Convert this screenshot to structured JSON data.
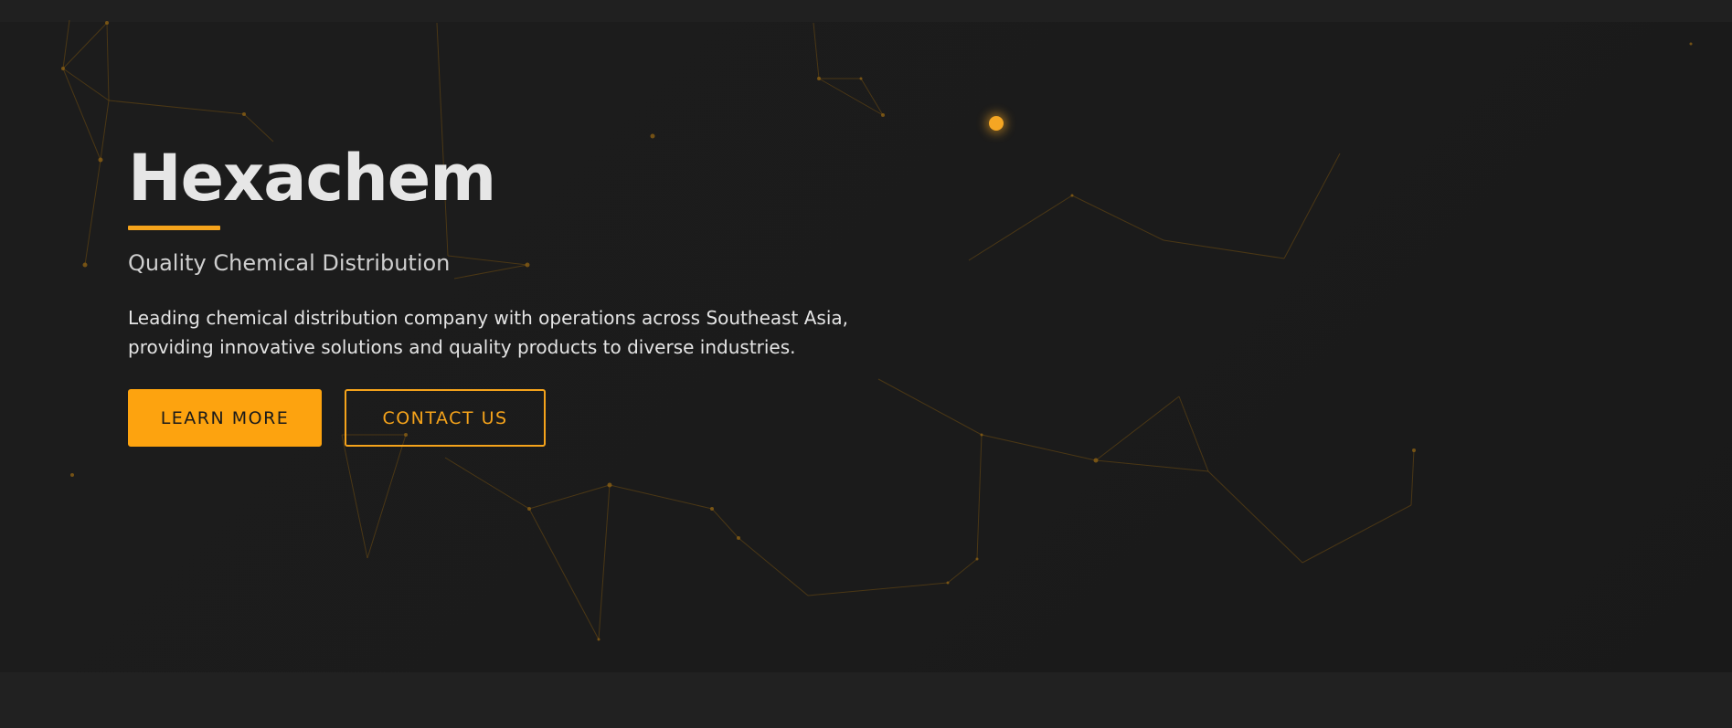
{
  "hero": {
    "title": "Hexachem",
    "subtitle": "Quality Chemical Distribution",
    "description": "Leading chemical distribution company with operations across Southeast Asia, providing innovative solutions and quality products to diverse industries.",
    "buttons": {
      "learn_more": "LEARN MORE",
      "contact_us": "CONTACT US"
    }
  },
  "colors": {
    "accent": "#fda30f",
    "background": "#1b1b1b",
    "title_text": "#e6e6e6",
    "body_text": "#e4e4e4"
  }
}
